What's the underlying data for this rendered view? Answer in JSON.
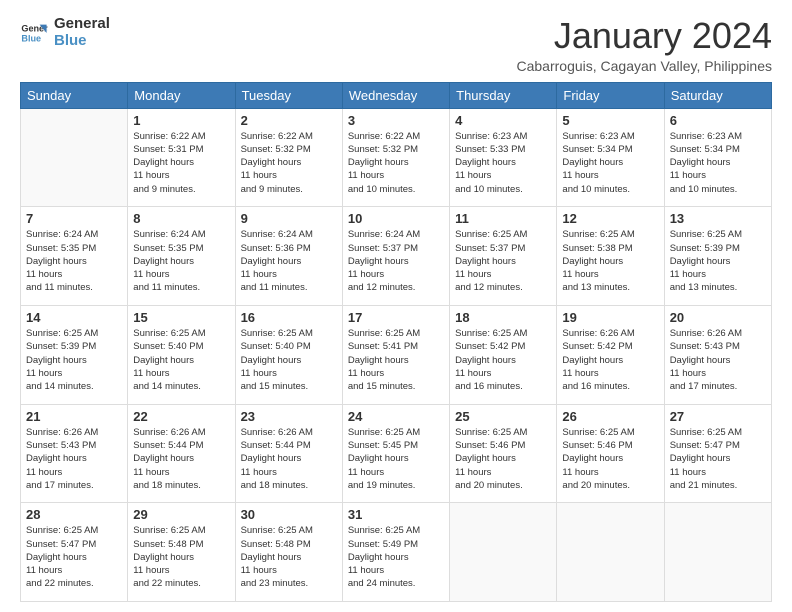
{
  "logo": {
    "line1": "General",
    "line2": "Blue"
  },
  "title": "January 2024",
  "subtitle": "Cabarroguis, Cagayan Valley, Philippines",
  "days_of_week": [
    "Sunday",
    "Monday",
    "Tuesday",
    "Wednesday",
    "Thursday",
    "Friday",
    "Saturday"
  ],
  "weeks": [
    [
      {
        "day": "",
        "sunrise": "",
        "sunset": "",
        "daylight": ""
      },
      {
        "day": "1",
        "sunrise": "6:22 AM",
        "sunset": "5:31 PM",
        "daylight": "11 hours and 9 minutes."
      },
      {
        "day": "2",
        "sunrise": "6:22 AM",
        "sunset": "5:32 PM",
        "daylight": "11 hours and 9 minutes."
      },
      {
        "day": "3",
        "sunrise": "6:22 AM",
        "sunset": "5:32 PM",
        "daylight": "11 hours and 10 minutes."
      },
      {
        "day": "4",
        "sunrise": "6:23 AM",
        "sunset": "5:33 PM",
        "daylight": "11 hours and 10 minutes."
      },
      {
        "day": "5",
        "sunrise": "6:23 AM",
        "sunset": "5:34 PM",
        "daylight": "11 hours and 10 minutes."
      },
      {
        "day": "6",
        "sunrise": "6:23 AM",
        "sunset": "5:34 PM",
        "daylight": "11 hours and 10 minutes."
      }
    ],
    [
      {
        "day": "7",
        "sunrise": "6:24 AM",
        "sunset": "5:35 PM",
        "daylight": "11 hours and 11 minutes."
      },
      {
        "day": "8",
        "sunrise": "6:24 AM",
        "sunset": "5:35 PM",
        "daylight": "11 hours and 11 minutes."
      },
      {
        "day": "9",
        "sunrise": "6:24 AM",
        "sunset": "5:36 PM",
        "daylight": "11 hours and 11 minutes."
      },
      {
        "day": "10",
        "sunrise": "6:24 AM",
        "sunset": "5:37 PM",
        "daylight": "11 hours and 12 minutes."
      },
      {
        "day": "11",
        "sunrise": "6:25 AM",
        "sunset": "5:37 PM",
        "daylight": "11 hours and 12 minutes."
      },
      {
        "day": "12",
        "sunrise": "6:25 AM",
        "sunset": "5:38 PM",
        "daylight": "11 hours and 13 minutes."
      },
      {
        "day": "13",
        "sunrise": "6:25 AM",
        "sunset": "5:39 PM",
        "daylight": "11 hours and 13 minutes."
      }
    ],
    [
      {
        "day": "14",
        "sunrise": "6:25 AM",
        "sunset": "5:39 PM",
        "daylight": "11 hours and 14 minutes."
      },
      {
        "day": "15",
        "sunrise": "6:25 AM",
        "sunset": "5:40 PM",
        "daylight": "11 hours and 14 minutes."
      },
      {
        "day": "16",
        "sunrise": "6:25 AM",
        "sunset": "5:40 PM",
        "daylight": "11 hours and 15 minutes."
      },
      {
        "day": "17",
        "sunrise": "6:25 AM",
        "sunset": "5:41 PM",
        "daylight": "11 hours and 15 minutes."
      },
      {
        "day": "18",
        "sunrise": "6:25 AM",
        "sunset": "5:42 PM",
        "daylight": "11 hours and 16 minutes."
      },
      {
        "day": "19",
        "sunrise": "6:26 AM",
        "sunset": "5:42 PM",
        "daylight": "11 hours and 16 minutes."
      },
      {
        "day": "20",
        "sunrise": "6:26 AM",
        "sunset": "5:43 PM",
        "daylight": "11 hours and 17 minutes."
      }
    ],
    [
      {
        "day": "21",
        "sunrise": "6:26 AM",
        "sunset": "5:43 PM",
        "daylight": "11 hours and 17 minutes."
      },
      {
        "day": "22",
        "sunrise": "6:26 AM",
        "sunset": "5:44 PM",
        "daylight": "11 hours and 18 minutes."
      },
      {
        "day": "23",
        "sunrise": "6:26 AM",
        "sunset": "5:44 PM",
        "daylight": "11 hours and 18 minutes."
      },
      {
        "day": "24",
        "sunrise": "6:25 AM",
        "sunset": "5:45 PM",
        "daylight": "11 hours and 19 minutes."
      },
      {
        "day": "25",
        "sunrise": "6:25 AM",
        "sunset": "5:46 PM",
        "daylight": "11 hours and 20 minutes."
      },
      {
        "day": "26",
        "sunrise": "6:25 AM",
        "sunset": "5:46 PM",
        "daylight": "11 hours and 20 minutes."
      },
      {
        "day": "27",
        "sunrise": "6:25 AM",
        "sunset": "5:47 PM",
        "daylight": "11 hours and 21 minutes."
      }
    ],
    [
      {
        "day": "28",
        "sunrise": "6:25 AM",
        "sunset": "5:47 PM",
        "daylight": "11 hours and 22 minutes."
      },
      {
        "day": "29",
        "sunrise": "6:25 AM",
        "sunset": "5:48 PM",
        "daylight": "11 hours and 22 minutes."
      },
      {
        "day": "30",
        "sunrise": "6:25 AM",
        "sunset": "5:48 PM",
        "daylight": "11 hours and 23 minutes."
      },
      {
        "day": "31",
        "sunrise": "6:25 AM",
        "sunset": "5:49 PM",
        "daylight": "11 hours and 24 minutes."
      },
      {
        "day": "",
        "sunrise": "",
        "sunset": "",
        "daylight": ""
      },
      {
        "day": "",
        "sunrise": "",
        "sunset": "",
        "daylight": ""
      },
      {
        "day": "",
        "sunrise": "",
        "sunset": "",
        "daylight": ""
      }
    ]
  ]
}
